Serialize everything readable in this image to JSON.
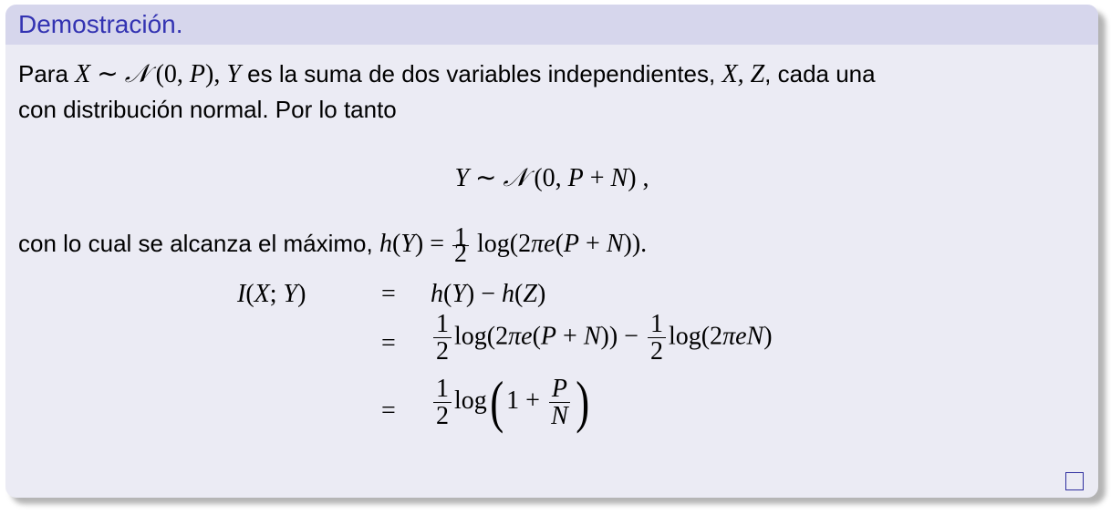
{
  "block": {
    "title": "Demostración."
  },
  "para1": {
    "t1": "Para ",
    "t2": " es la suma de dos variables independientes, ",
    "t3": ", cada una",
    "t4": "con distribución normal. Por lo tanto"
  },
  "para2": {
    "t1": "con lo cual se alcanza el máximo, "
  },
  "colors": {
    "title_text": "#3333b2",
    "title_bg": "#d6d6ec",
    "body_bg": "#ebebf4",
    "qed_border": "#2f2f9f"
  },
  "qed_symbol": "square"
}
